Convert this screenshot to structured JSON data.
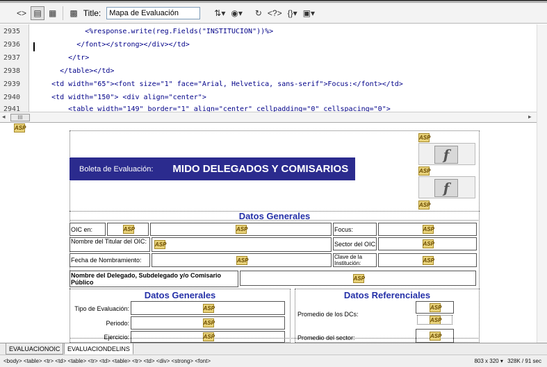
{
  "toolbar": {
    "title_label": "Title:",
    "title_value": "Mapa de Evaluación"
  },
  "code": {
    "lines": [
      {
        "num": "2935",
        "text": "            <%response.write(reg.Fields(\"INSTITUCION\"))%>"
      },
      {
        "num": "2936",
        "text": "          </font></strong></div></td>"
      },
      {
        "num": "2937",
        "text": "        </tr>"
      },
      {
        "num": "2938",
        "text": "      </table></td>"
      },
      {
        "num": "2939",
        "text": "    <td width=\"65\"><font size=\"1\" face=\"Arial, Helvetica, sans-serif\">Focus:</font></td>"
      },
      {
        "num": "2940",
        "text": "    <td width=\"150\"> <div align=\"center\">"
      },
      {
        "num": "2941",
        "text": "        <table width=\"149\" border=\"1\" align=\"center\" cellpadding=\"0\" cellspacing=\"0\">"
      }
    ],
    "scroll_thumb": "III"
  },
  "design": {
    "asp_label": "ASP",
    "flash_glyph": "f",
    "boleta_label": "Boleta de Evaluación:",
    "boleta_title": "MIDO DELEGADOS Y COMISARIOS",
    "section_datos_generales": "Datos Generales",
    "section_datos_generales_2": "Datos Generales",
    "section_datos_referenciales": "Datos Referenciales",
    "labels": {
      "oic": "OIC en:",
      "focus": "Focus:",
      "nombre_titular": "Nombre del Titular del OIC:",
      "sector": "Sector del OIC:",
      "fecha": "Fecha de Nombramiento:",
      "clave": "Clave de la Institución:",
      "nombre_delegado": "Nombre del Delegado, Subdelegado y/o Comisario Público",
      "tipo": "Tipo de Evaluación:",
      "periodo": "Periodo:",
      "ejercicio": "Ejercicio:",
      "promedio_dcs": "Promedio de los DCs:",
      "promedio_sector": "Promedio del sector:"
    }
  },
  "tabs": [
    {
      "label": "EVALUACIONOIC",
      "active": false
    },
    {
      "label": "EVALUACIONDELINS",
      "active": true
    }
  ],
  "status": {
    "breadcrumb": "<body> <table> <tr> <td> <table> <tr> <td> <table> <tr> <td> <div> <strong> <font>",
    "window_size": "803 x 320",
    "dropdown": "▾",
    "file_info": "328K / 91 sec"
  }
}
